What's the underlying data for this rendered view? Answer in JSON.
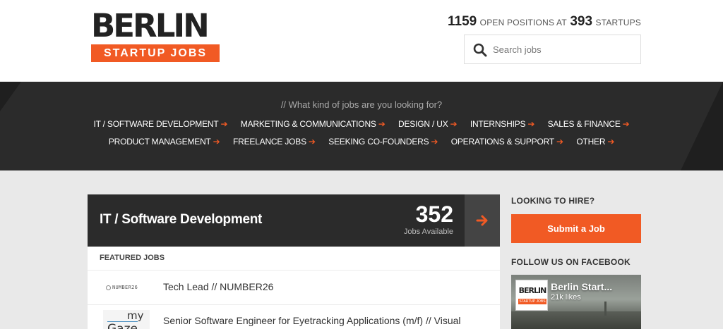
{
  "brand": {
    "logo_top": "BERLIN",
    "logo_bottom": "STARTUP JOBS",
    "accent_color": "#f15a24",
    "dark_color": "#2b2b2b"
  },
  "header": {
    "positions_count": "1159",
    "positions_label": "OPEN POSITIONS AT",
    "startups_count": "393",
    "startups_label": "STARTUPS",
    "search_placeholder": "Search jobs",
    "search_icon": "search-icon"
  },
  "categories": {
    "prompt": "// What kind of jobs are you looking for?",
    "row1": [
      {
        "label": "IT / SOFTWARE DEVELOPMENT"
      },
      {
        "label": "MARKETING & COMMUNICATIONS"
      },
      {
        "label": "DESIGN / UX"
      },
      {
        "label": "INTERNSHIPS"
      },
      {
        "label": "SALES & FINANCE"
      }
    ],
    "row2": [
      {
        "label": "PRODUCT MANAGEMENT"
      },
      {
        "label": "FREELANCE JOBS"
      },
      {
        "label": "SEEKING CO-FOUNDERS"
      },
      {
        "label": "OPERATIONS & SUPPORT"
      },
      {
        "label": "OTHER"
      }
    ],
    "arrow_glyph": "➔"
  },
  "main": {
    "title": "IT / Software Development",
    "count": "352",
    "count_label": "Jobs Available",
    "featured_label": "FEATURED JOBS",
    "jobs": [
      {
        "title": "Tech Lead // NUMBER26",
        "logo_text": "NUMBER26"
      },
      {
        "title": "Senior Software Engineer for Eyetracking Applications (m/f) // Visual",
        "logo_text_a": "my",
        "logo_text_b": "Gaze"
      }
    ]
  },
  "sidebar": {
    "hire_title": "LOOKING TO HIRE?",
    "submit_label": "Submit a Job",
    "facebook_title": "FOLLOW US ON FACEBOOK",
    "fb_page_name": "Berlin Start...",
    "fb_likes": "21k likes",
    "fb_logo_top": "BERLIN",
    "fb_logo_bottom": "STARTUP JOBS"
  }
}
